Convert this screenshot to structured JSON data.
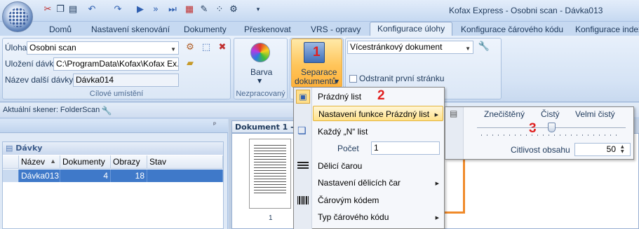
{
  "window": {
    "title": "Kofax Express - Osobni scan - Dávka013"
  },
  "quick_access": [
    "scissors-icon",
    "copy-icon",
    "paste-icon",
    "undo-icon",
    "redo-icon",
    "play-icon",
    "fast-forward-icon",
    "skip-end-icon",
    "grid-icon",
    "tools-icon",
    "dots-icon",
    "gear-icon",
    "chevron-down-icon"
  ],
  "tabs": [
    "Domů",
    "Nastavení skenování",
    "Dokumenty",
    "Přeskenovat",
    "VRS - opravy",
    "Konfigurace úlohy",
    "Konfigurace čárového kódu",
    "Konfigurace indexu"
  ],
  "active_tab": "Konfigurace úlohy",
  "cilove": {
    "uloha_label": "Úloha",
    "uloha_value": "Osobni scan",
    "ulozeni_label": "Uložení dávky",
    "ulozeni_value": "C:\\ProgramData\\Kofax\\Kofax Ex...",
    "nazev_label": "Název další dávky",
    "nazev_value": "Dávka014",
    "group_label": "Cílové umístění"
  },
  "nezpracovany": {
    "barva_label": "Barva",
    "group_label": "Nezpracovaný"
  },
  "separace": {
    "label_line1": "Separace",
    "label_line2": "dokumentů",
    "badge": "1"
  },
  "doc_options": {
    "mode": "Vícestránkový dokument",
    "checkbox_label": "Odstranit první stránku"
  },
  "status": {
    "scanner": "Aktuální skener: FolderScan"
  },
  "pane": {
    "pin": "ᵖ",
    "davky_title": "Dávky",
    "columns": [
      "Název",
      "Dokumenty",
      "Obrazy",
      "Stav"
    ],
    "rows": [
      {
        "nazev": "Dávka013",
        "dokumenty": "4",
        "obrazy": "18",
        "stav": ""
      }
    ]
  },
  "document": {
    "header": "Dokument 1 - 4",
    "page_number": "1"
  },
  "menu": {
    "items": [
      {
        "label": "Prázdný list",
        "icon": "blank-page-icon",
        "badge": "2"
      },
      {
        "label": "Nastavení funkce Prázdný list",
        "submenu": true
      },
      {
        "label": "Každý „N“ list",
        "icon": "pages-icon"
      },
      {
        "label": "Počet",
        "value": "1"
      },
      {
        "label": "Dělicí čarou",
        "icon": "lines-icon"
      },
      {
        "label": "Nastavení dělicích čar",
        "submenu": true
      },
      {
        "label": "Čárovým kódem",
        "icon": "barcode-icon"
      },
      {
        "label": "Typ čárového kódu",
        "submenu": true
      }
    ]
  },
  "submenu": {
    "scale": [
      "Znečištěný",
      "Čistý",
      "Velmi čistý"
    ],
    "badge": "3",
    "slider_value": 0.5,
    "citlivost_label": "Citlivost obsahu",
    "citlivost_value": "50"
  }
}
